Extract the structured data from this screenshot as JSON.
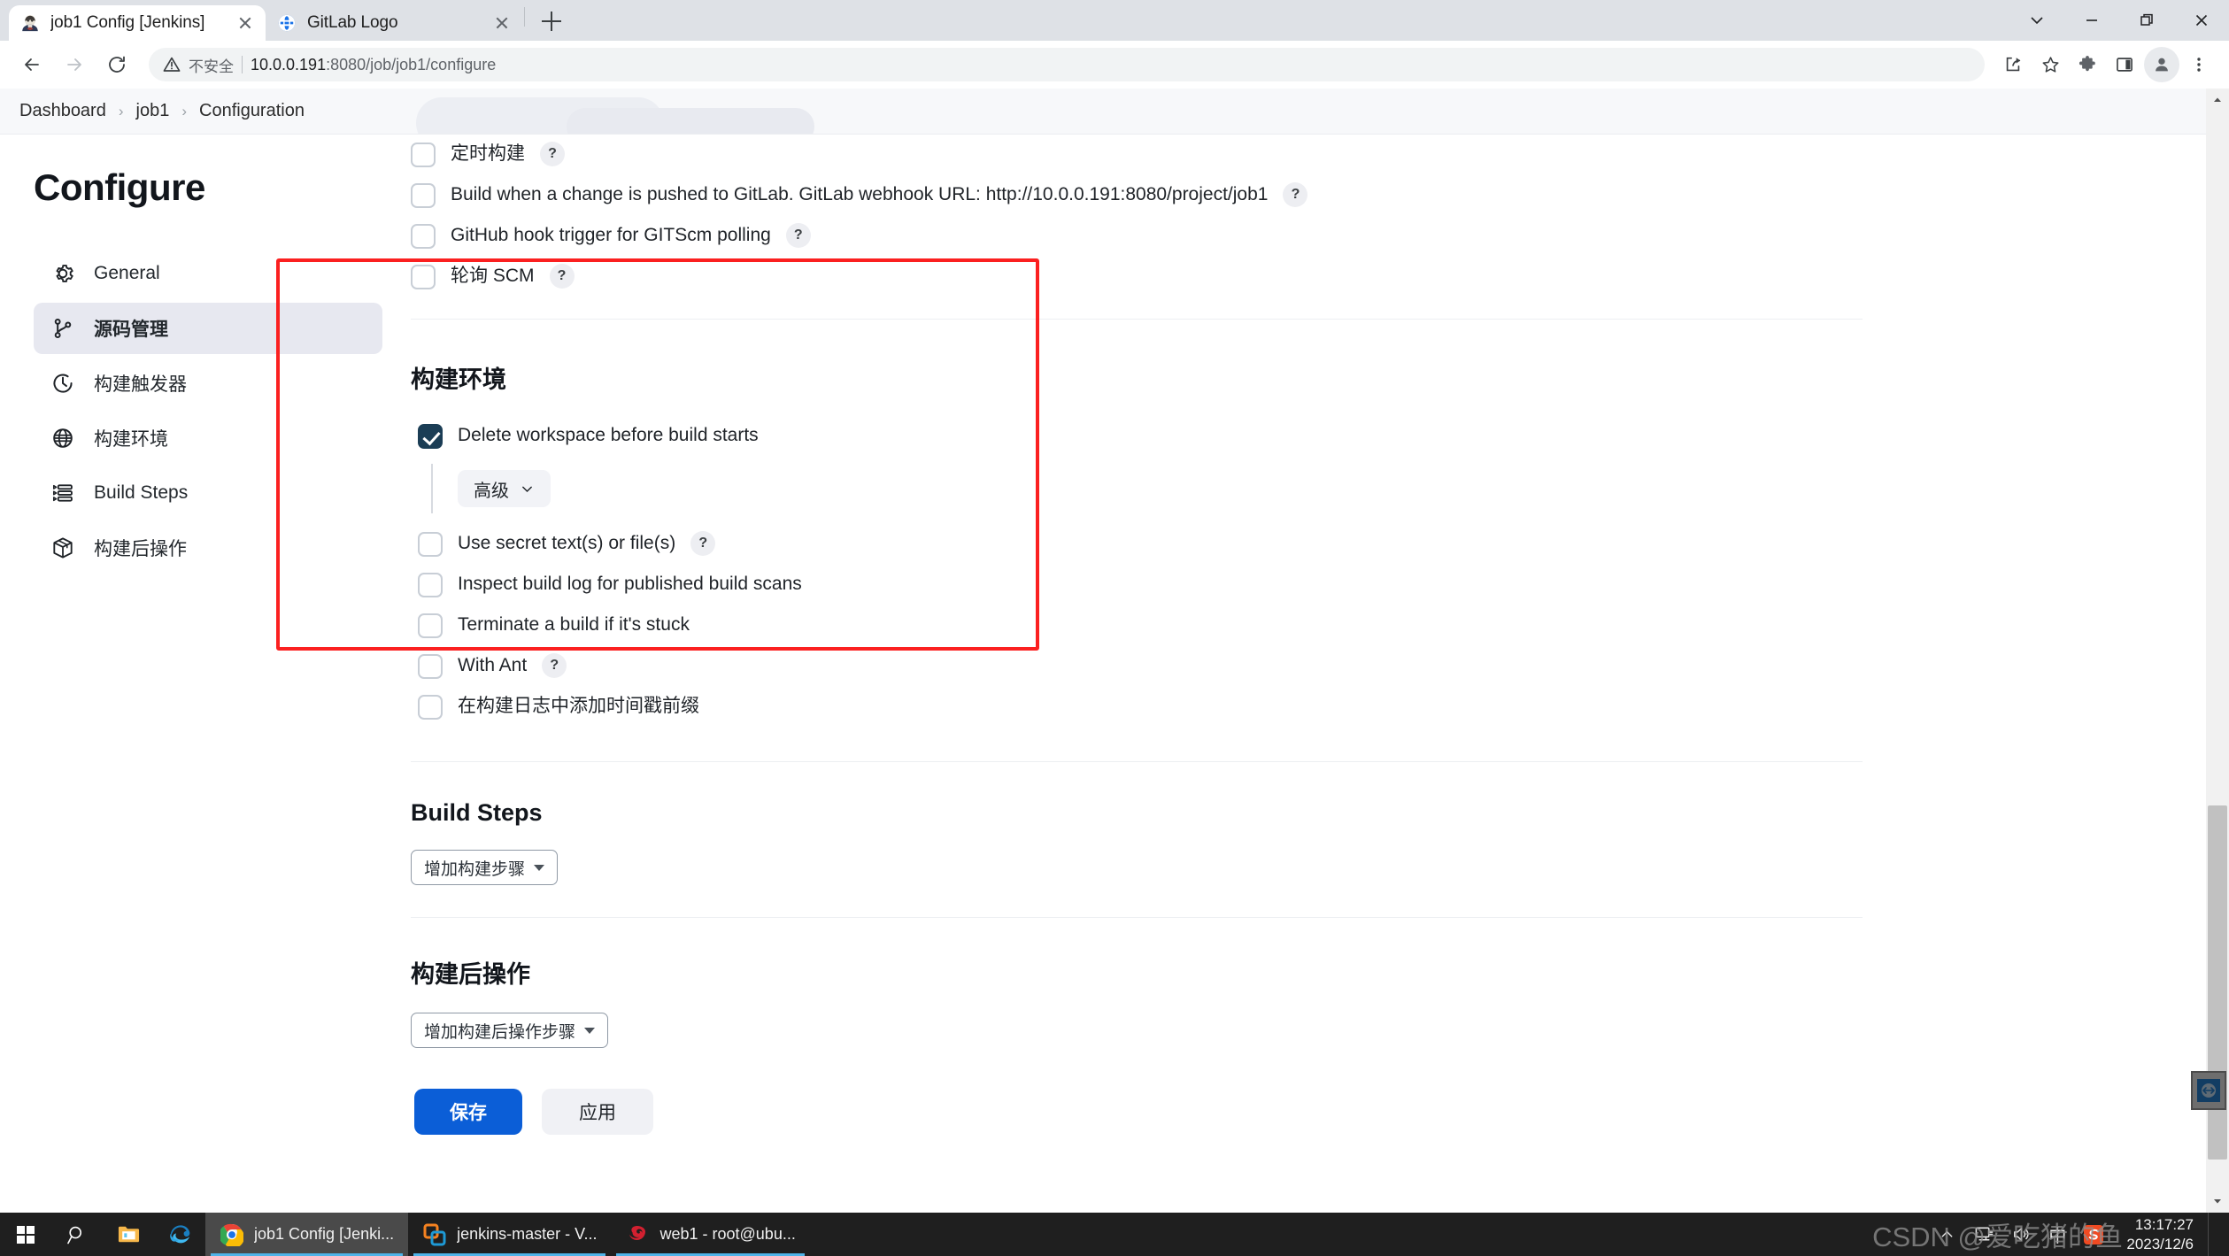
{
  "browser": {
    "tabs": [
      {
        "title": "job1 Config [Jenkins]",
        "favicon": "jenkins-icon",
        "active": true
      },
      {
        "title": "GitLab Logo",
        "favicon": "gitlab-globe-icon",
        "active": false
      }
    ],
    "new_tab_label": "+",
    "window_controls": [
      "chevron-down",
      "minimize",
      "restore",
      "close"
    ],
    "nav": {
      "back": "←",
      "forward": "→",
      "reload": "⟳"
    },
    "omnibox": {
      "security_label": "不安全",
      "url_host": "10.0.0.191",
      "url_rest": ":8080/job/job1/configure"
    },
    "toolbar_icons": [
      "share-icon",
      "bookmark-star-icon",
      "extensions-puzzle-icon",
      "side-panel-icon",
      "profile-avatar-icon",
      "chrome-menu-icon"
    ]
  },
  "breadcrumb": {
    "items": [
      "Dashboard",
      "job1",
      "Configuration"
    ],
    "separator": "›"
  },
  "sidebar": {
    "title": "Configure",
    "items": [
      {
        "label": "General",
        "icon": "gear-icon",
        "active": false
      },
      {
        "label": "源码管理",
        "icon": "source-branch-icon",
        "active": true
      },
      {
        "label": "构建触发器",
        "icon": "clock-icon",
        "active": false
      },
      {
        "label": "构建环境",
        "icon": "globe-icon",
        "active": false
      },
      {
        "label": "Build Steps",
        "icon": "list-steps-icon",
        "active": false
      },
      {
        "label": "构建后操作",
        "icon": "package-box-icon",
        "active": false
      }
    ]
  },
  "triggers": {
    "checkboxes": [
      {
        "label": "定时构建",
        "checked": false,
        "help": "?"
      },
      {
        "label": "Build when a change is pushed to GitLab. GitLab webhook URL: http://10.0.0.191:8080/project/job1",
        "checked": false,
        "help": "?"
      },
      {
        "label": "GitHub hook trigger for GITScm polling",
        "checked": false,
        "help": "?"
      },
      {
        "label": "轮询 SCM",
        "checked": false,
        "help": "?"
      }
    ]
  },
  "build_env": {
    "title": "构建环境",
    "highlighted": true,
    "highlight_color": "#fb2020",
    "checkboxes": [
      {
        "label": "Delete workspace before build starts",
        "checked": true,
        "help": null
      },
      {
        "label": "Use secret text(s) or file(s)",
        "checked": false,
        "help": "?"
      },
      {
        "label": "Inspect build log for published build scans",
        "checked": false,
        "help": null
      },
      {
        "label": "Terminate a build if it's stuck",
        "checked": false,
        "help": null
      },
      {
        "label": "With Ant",
        "checked": false,
        "help": "?"
      },
      {
        "label": "在构建日志中添加时间戳前缀",
        "checked": false,
        "help": null
      }
    ],
    "advanced_button": "高级"
  },
  "build_steps": {
    "title": "Build Steps",
    "add_button": "增加构建步骤"
  },
  "post_build": {
    "title": "构建后操作",
    "add_button": "增加构建后操作步骤"
  },
  "submit": {
    "save": "保存",
    "apply": "应用",
    "save_color": "#0b5ed7"
  },
  "taskbar": {
    "system_buttons": [
      "start-windows-icon",
      "search-icon",
      "file-explorer-icon",
      "edge-browser-icon"
    ],
    "apps": [
      {
        "label": "job1 Config [Jenki...",
        "icon": "chrome-icon",
        "active": true
      },
      {
        "label": "jenkins-master - V...",
        "icon": "vmware-icon",
        "active": false
      },
      {
        "label": "web1 - root@ubu...",
        "icon": "xshell-icon",
        "active": false
      }
    ],
    "tray": [
      "chevron-up-icon",
      "network-icon",
      "volume-icon"
    ],
    "ime": "中",
    "tray_app": "sogou-icon",
    "clock_time": "13:17:27",
    "clock_date": "2023/12/6"
  },
  "watermark": "CSDN @爱吃猪的鱼"
}
